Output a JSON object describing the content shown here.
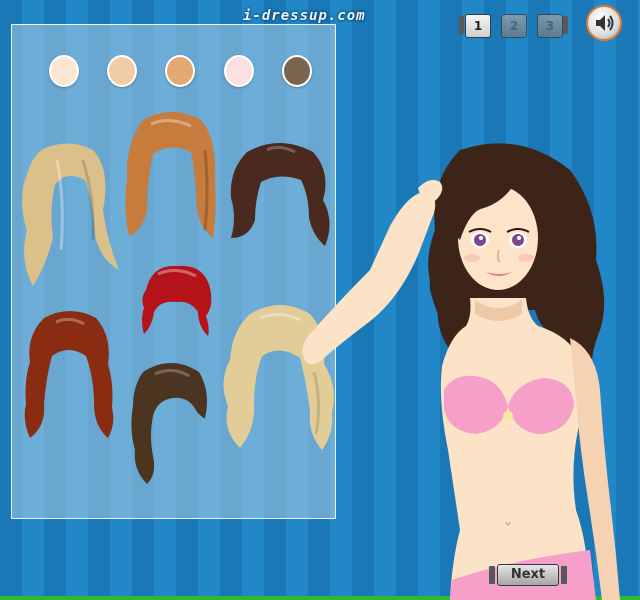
{
  "site": {
    "logo_text": "i-dressup.com"
  },
  "pages": {
    "items": [
      "1",
      "2",
      "3"
    ],
    "active": "1"
  },
  "sound": {
    "icon": "speaker-icon"
  },
  "skin_tones": [
    "#fde7d2",
    "#f1cda7",
    "#e4a872",
    "#fbe0e3",
    "#7a6450"
  ],
  "hairstyles": [
    {
      "name": "long-blonde-wavy-hair",
      "color": "#dcc08a"
    },
    {
      "name": "long-auburn-straight-hair",
      "color": "#c77c3e"
    },
    {
      "name": "dark-brown-wavy-hair",
      "color": "#4a2a1e"
    },
    {
      "name": "red-updo-hair",
      "color": "#b5131a"
    },
    {
      "name": "auburn-pigtail-hair",
      "color": "#8a2c12"
    },
    {
      "name": "dark-brown-side-swept-hair",
      "color": "#4b3420"
    },
    {
      "name": "blonde-curly-hair",
      "color": "#e2cc98"
    }
  ],
  "buttons": {
    "next_label": "Next"
  }
}
